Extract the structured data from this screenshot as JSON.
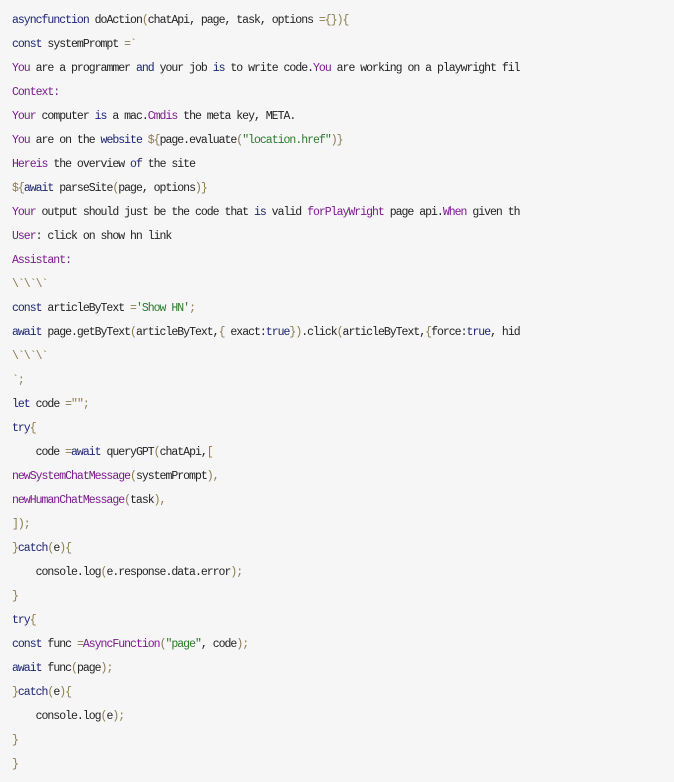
{
  "code_lines": [
    [
      [
        "async",
        "k"
      ],
      [
        "function",
        "k"
      ],
      [
        " doAction",
        "t"
      ],
      [
        "(",
        "o"
      ],
      [
        "chatApi, page, task, options ",
        "t"
      ],
      [
        "={}",
        "o"
      ],
      [
        ")",
        "o"
      ],
      [
        "{",
        "o"
      ]
    ],
    [
      [
        "const",
        "k"
      ],
      [
        " systemPrompt ",
        "t"
      ],
      [
        "=`",
        "o"
      ]
    ],
    [
      [
        "You",
        "p"
      ],
      [
        " are a programmer ",
        "t"
      ],
      [
        "and",
        "k"
      ],
      [
        " your job ",
        "t"
      ],
      [
        "is",
        "k"
      ],
      [
        " to write code.",
        "t"
      ],
      [
        "You",
        "p"
      ],
      [
        " are working on a playwright fil",
        "t"
      ]
    ],
    [
      [
        "Context:",
        "p"
      ]
    ],
    [
      [
        "Your",
        "p"
      ],
      [
        " computer ",
        "t"
      ],
      [
        "is",
        "k"
      ],
      [
        " a mac.",
        "t"
      ],
      [
        "Cmdis",
        "p"
      ],
      [
        " the meta key, META.",
        "t"
      ]
    ],
    [
      [
        "You",
        "p"
      ],
      [
        " are on the ",
        "t"
      ],
      [
        "website",
        "k"
      ],
      [
        " ",
        "t"
      ],
      [
        "${",
        "o"
      ],
      [
        "page.evaluate",
        "t"
      ],
      [
        "(",
        "o"
      ],
      [
        "\"location.href\"",
        "s"
      ],
      [
        ")}",
        "o"
      ]
    ],
    [
      [
        "Hereis",
        "p"
      ],
      [
        " the overview ",
        "t"
      ],
      [
        "of",
        "k"
      ],
      [
        " the site",
        "t"
      ]
    ],
    [
      [
        "${",
        "o"
      ],
      [
        "await",
        "k"
      ],
      [
        " parseSite",
        "t"
      ],
      [
        "(",
        "o"
      ],
      [
        "page, options",
        "t"
      ],
      [
        ")}",
        "o"
      ]
    ],
    [
      [
        "Your",
        "p"
      ],
      [
        " output should just be the code that ",
        "t"
      ],
      [
        "is",
        "k"
      ],
      [
        " valid ",
        "t"
      ],
      [
        "forPlayWright",
        "p"
      ],
      [
        " page api.",
        "t"
      ],
      [
        "When",
        "p"
      ],
      [
        " given th",
        "t"
      ]
    ],
    [
      [
        "User",
        "p"
      ],
      [
        ": click on show hn link",
        "t"
      ]
    ],
    [
      [
        "Assistant:",
        "p"
      ]
    ],
    [
      [
        "\\`\\`\\`",
        "o"
      ]
    ],
    [
      [
        "const",
        "k"
      ],
      [
        " articleByText ",
        "t"
      ],
      [
        "=",
        "o"
      ],
      [
        "'Show HN'",
        "s"
      ],
      [
        ";",
        "o"
      ]
    ],
    [
      [
        "await",
        "k"
      ],
      [
        " page.getByText",
        "t"
      ],
      [
        "(",
        "o"
      ],
      [
        "articleByText,",
        "t"
      ],
      [
        "{",
        "o"
      ],
      [
        " exact:",
        "t"
      ],
      [
        "true",
        "k"
      ],
      [
        "}",
        "o"
      ],
      [
        ")",
        "o"
      ],
      [
        ".click",
        "t"
      ],
      [
        "(",
        "o"
      ],
      [
        "articleByText,",
        "t"
      ],
      [
        "{",
        "o"
      ],
      [
        "force:",
        "t"
      ],
      [
        "true",
        "k"
      ],
      [
        ", hid",
        "t"
      ]
    ],
    [
      [
        "\\`\\`\\`",
        "o"
      ]
    ],
    [
      [
        "`;",
        "o"
      ]
    ],
    [
      [
        "let",
        "k"
      ],
      [
        " code ",
        "t"
      ],
      [
        "=\"\";",
        "o"
      ]
    ],
    [
      [
        "try",
        "k"
      ],
      [
        "{",
        "o"
      ]
    ],
    [
      [
        "    code ",
        "t"
      ],
      [
        "=",
        "o"
      ],
      [
        "await",
        "k"
      ],
      [
        " queryGPT",
        "t"
      ],
      [
        "(",
        "o"
      ],
      [
        "chatApi,",
        "t"
      ],
      [
        "[",
        "o"
      ]
    ],
    [
      [
        "newSystemChatMessage",
        "p"
      ],
      [
        "(",
        "o"
      ],
      [
        "systemPrompt",
        "t"
      ],
      [
        "),",
        "o"
      ]
    ],
    [
      [
        "newHumanChatMessage",
        "p"
      ],
      [
        "(",
        "o"
      ],
      [
        "task",
        "t"
      ],
      [
        "),",
        "o"
      ]
    ],
    [
      [
        "]);",
        "o"
      ]
    ],
    [
      [
        "}",
        "o"
      ],
      [
        "catch",
        "k"
      ],
      [
        "(",
        "o"
      ],
      [
        "e",
        "t"
      ],
      [
        ")",
        "o"
      ],
      [
        "{",
        "o"
      ]
    ],
    [
      [
        "    console.log",
        "t"
      ],
      [
        "(",
        "o"
      ],
      [
        "e.response.data.error",
        "t"
      ],
      [
        ");",
        "o"
      ]
    ],
    [
      [
        "}",
        "o"
      ]
    ],
    [
      [
        "try",
        "k"
      ],
      [
        "{",
        "o"
      ]
    ],
    [
      [
        "const",
        "k"
      ],
      [
        " func ",
        "t"
      ],
      [
        "=",
        "o"
      ],
      [
        "AsyncFunction",
        "p"
      ],
      [
        "(",
        "o"
      ],
      [
        "\"page\"",
        "s"
      ],
      [
        ", code",
        "t"
      ],
      [
        ");",
        "o"
      ]
    ],
    [
      [
        "await",
        "k"
      ],
      [
        " func",
        "t"
      ],
      [
        "(",
        "o"
      ],
      [
        "page",
        "t"
      ],
      [
        ");",
        "o"
      ]
    ],
    [
      [
        "}",
        "o"
      ],
      [
        "catch",
        "k"
      ],
      [
        "(",
        "o"
      ],
      [
        "e",
        "t"
      ],
      [
        ")",
        "o"
      ],
      [
        "{",
        "o"
      ]
    ],
    [
      [
        "    console.log",
        "t"
      ],
      [
        "(",
        "o"
      ],
      [
        "e",
        "t"
      ],
      [
        ");",
        "o"
      ]
    ],
    [
      [
        "}",
        "o"
      ]
    ],
    [
      [
        "}",
        "o"
      ]
    ]
  ],
  "colors": {
    "background": "#f6f6f6",
    "keyword": "#1c2470",
    "identifier": "#7a1a8c",
    "string": "#2a7a2a",
    "punctuation": "#8a7a50",
    "text": "#222222"
  }
}
